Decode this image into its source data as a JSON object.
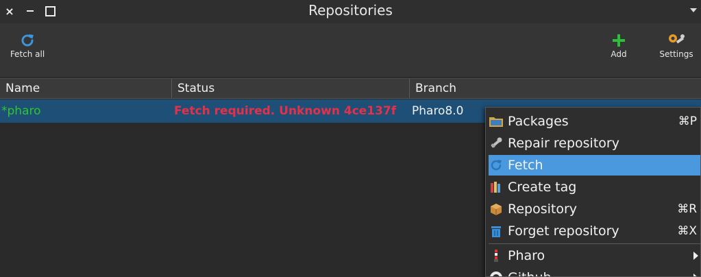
{
  "window": {
    "title": "Repositories",
    "close_glyph": "×"
  },
  "toolbar": {
    "fetch_all_label": "Fetch all",
    "add_label": "Add",
    "settings_label": "Settings"
  },
  "columns": {
    "name": "Name",
    "status": "Status",
    "branch": "Branch"
  },
  "rows": [
    {
      "name": "*pharo",
      "status": "Fetch required. Unknown 4ce137f",
      "branch": "Pharo8.0"
    }
  ],
  "context_menu": {
    "items": [
      {
        "label": "Packages",
        "shortcut": "⌘P",
        "icon": "folder-icon"
      },
      {
        "label": "Repair repository",
        "shortcut": "",
        "icon": "wrench-icon"
      },
      {
        "label": "Fetch",
        "shortcut": "",
        "icon": "refresh-icon",
        "highlighted": true
      },
      {
        "label": "Create tag",
        "shortcut": "",
        "icon": "books-icon"
      },
      {
        "label": "Repository",
        "shortcut": "⌘R",
        "icon": "box-icon"
      },
      {
        "label": "Forget repository",
        "shortcut": "⌘X",
        "icon": "trash-icon"
      },
      {
        "label": "Pharo",
        "shortcut": "",
        "icon": "pharo-icon",
        "submenu": true
      },
      {
        "label": "Github",
        "shortcut": "",
        "icon": "github-icon",
        "submenu": true
      }
    ]
  },
  "colors": {
    "selection_row": "#1e4f76",
    "status_error": "#e6304a",
    "dirty_name": "#2ec52e",
    "menu_highlight": "#4a98dd"
  }
}
